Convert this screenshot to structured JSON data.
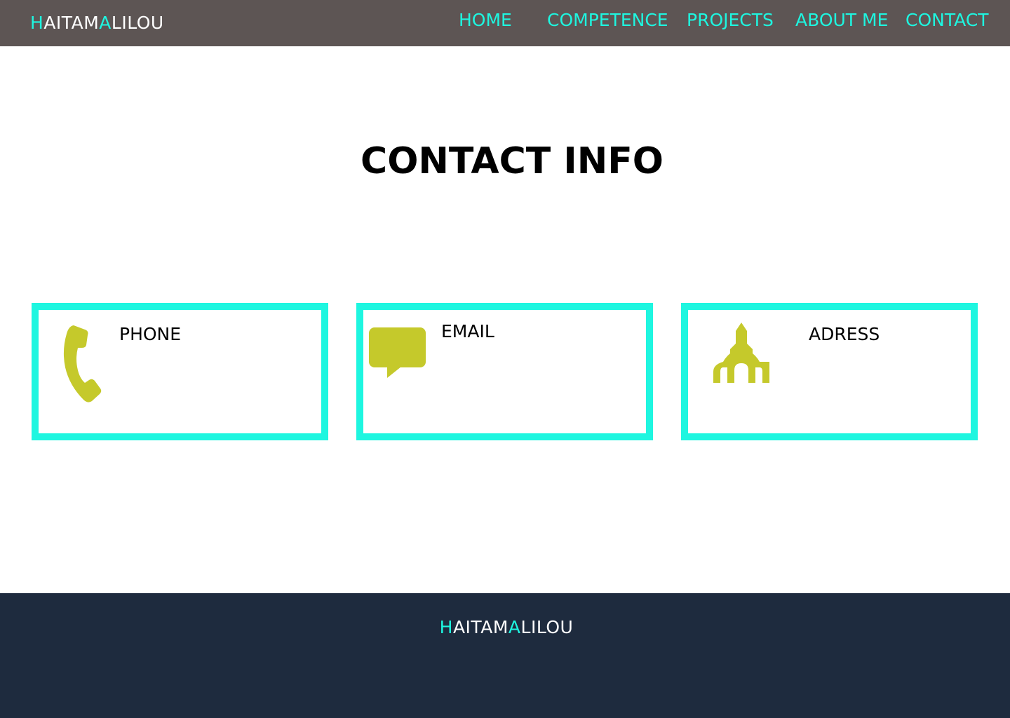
{
  "brand": {
    "first_initial": "H",
    "first_rest": "AITAM",
    "second_initial": "A",
    "second_rest": "LILOU"
  },
  "nav": {
    "items": [
      {
        "label": "HOME"
      },
      {
        "label": "COMPETENCE"
      },
      {
        "label": "PROJECTS"
      },
      {
        "label": "ABOUT ME"
      },
      {
        "label": "CONTACT"
      }
    ]
  },
  "main": {
    "heading": "CONTACT INFO",
    "cards": [
      {
        "title": "PHONE",
        "icon": "phone-icon"
      },
      {
        "title": "EMAIL",
        "icon": "chat-bubble-icon"
      },
      {
        "title": "ADRESS",
        "icon": "church-icon"
      }
    ]
  },
  "footer": {
    "brand": {
      "first_initial": "H",
      "first_rest": "AITAM",
      "second_initial": "A",
      "second_rest": "LILOU"
    }
  },
  "colors": {
    "navbar_bg": "#5d5554",
    "accent": "#1ef6e0",
    "icon": "#c5c92b",
    "footer_bg": "#1e2b3e"
  }
}
